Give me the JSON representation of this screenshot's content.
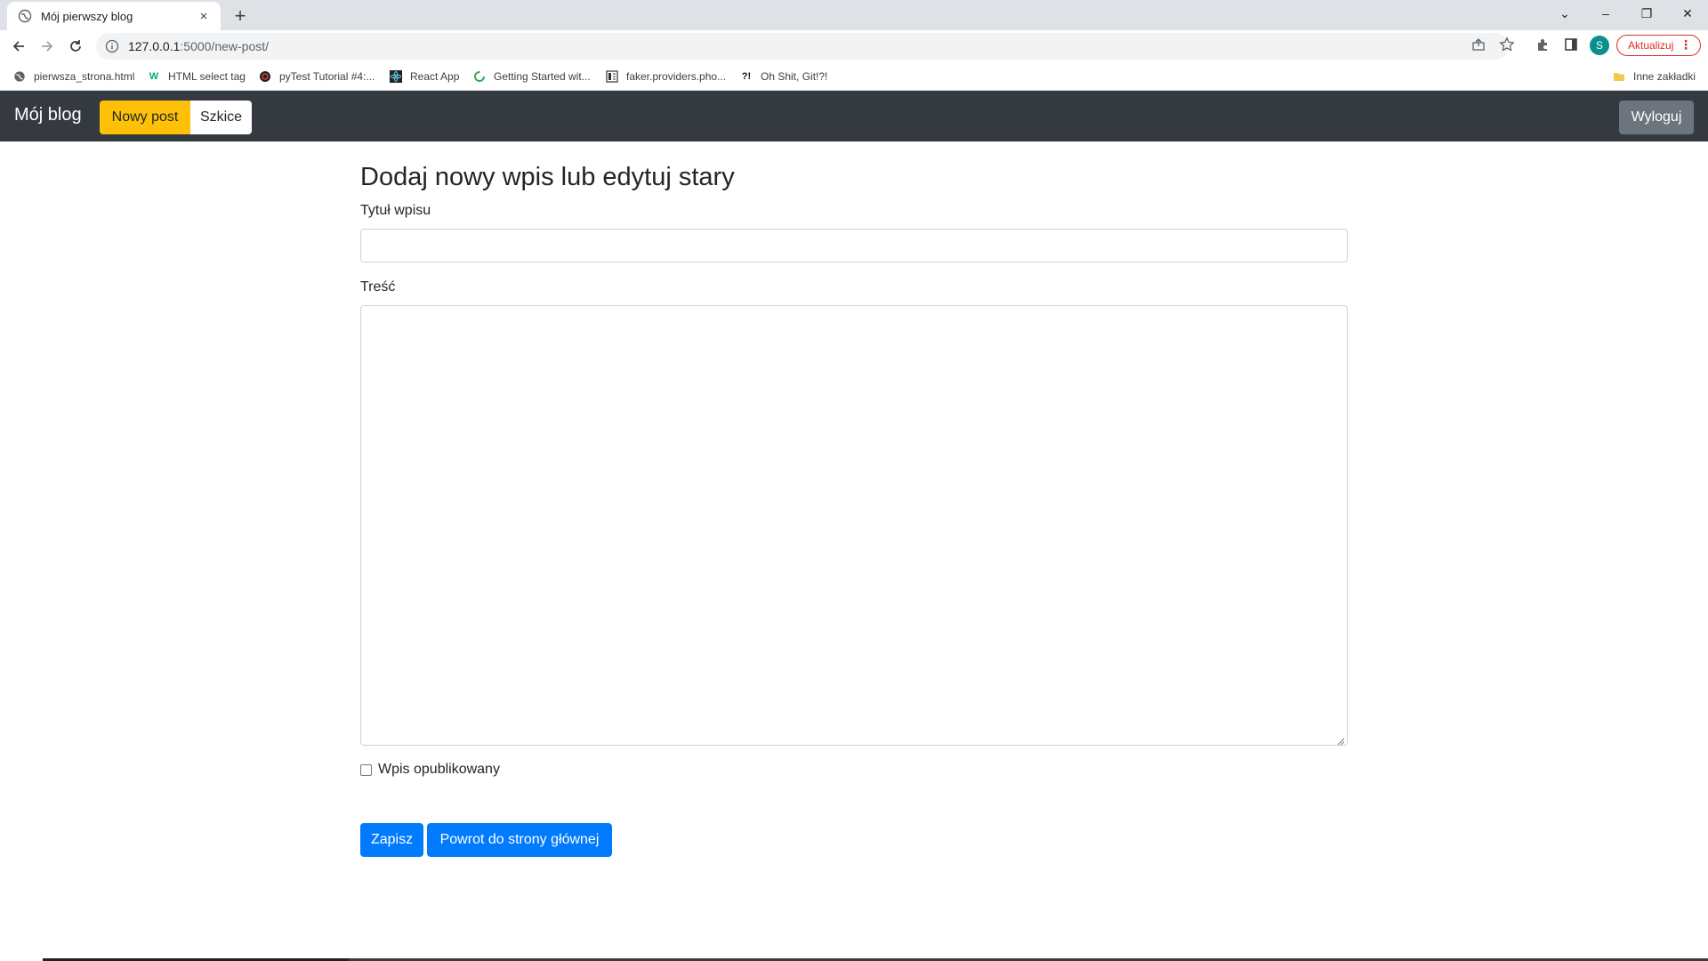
{
  "browser": {
    "tab_title": "Mój pierwszy blog",
    "tab_close": "×",
    "new_tab": "+",
    "url_host": "127.0.0.1",
    "url_path": ":5000/new-post/",
    "profile_initial": "S",
    "update_label": "Aktualizuj",
    "menu_dots": "⋮",
    "window_controls": {
      "list": "⌄",
      "minimize": "–",
      "restore": "❐",
      "close": "✕"
    },
    "bookmarks": [
      {
        "label": "pierwsza_strona.html",
        "icon": "globe-icon"
      },
      {
        "label": "HTML select tag",
        "icon": "w3-icon"
      },
      {
        "label": "pyTest Tutorial #4:...",
        "icon": "quora-icon"
      },
      {
        "label": "React App",
        "icon": "react-icon"
      },
      {
        "label": "Getting Started wit...",
        "icon": "spinner-icon"
      },
      {
        "label": "faker.providers.pho...",
        "icon": "doc-icon"
      },
      {
        "label": "Oh Shit, Git!?!",
        "icon": "ohshit-icon"
      }
    ],
    "other_bookmarks": "Inne zakładki"
  },
  "navbar": {
    "brand": "Mój blog",
    "new_post": "Nowy post",
    "drafts": "Szkice",
    "logout": "Wyloguj"
  },
  "form": {
    "heading": "Dodaj nowy wpis lub edytuj stary",
    "title_label": "Tytuł wpisu",
    "title_value": "",
    "body_label": "Treść",
    "body_value": "",
    "published_label": "Wpis opublikowany",
    "published_checked": false,
    "save_button": "Zapisz",
    "back_button": "Powrot do strony głównej"
  },
  "colors": {
    "navbar_bg": "#343a40",
    "warning": "#ffc107",
    "primary": "#007bff",
    "secondary": "#6c757d"
  }
}
